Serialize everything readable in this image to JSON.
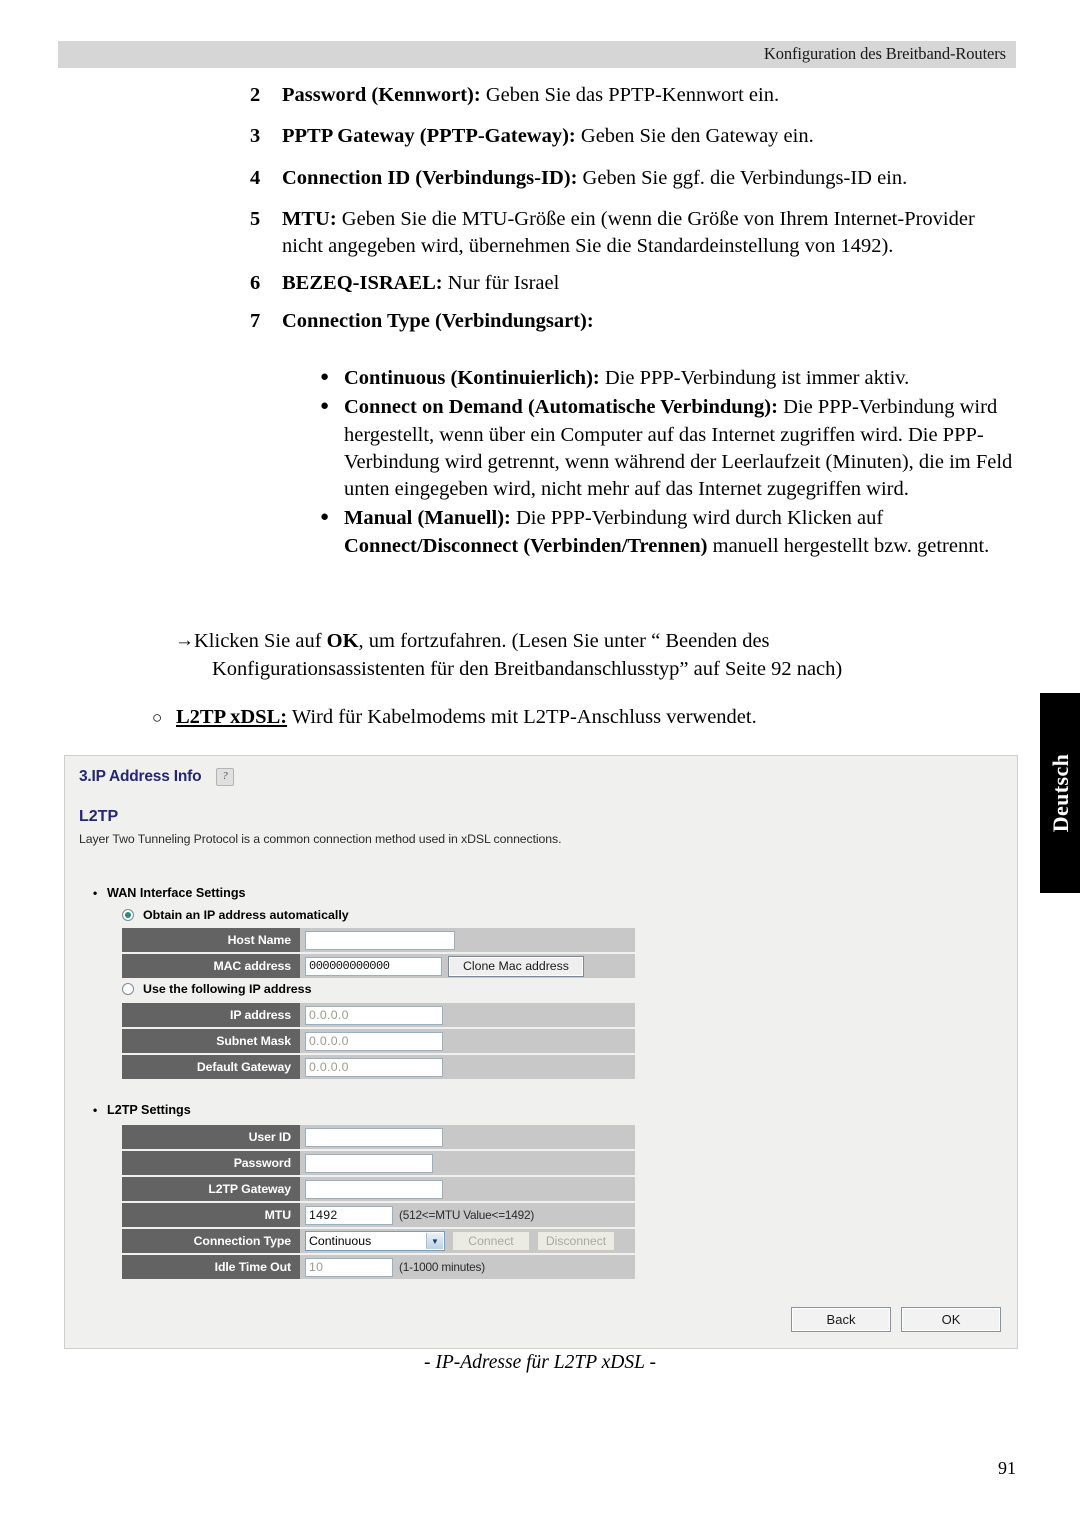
{
  "header": {
    "running_title": "Konfiguration des Breitband-Routers"
  },
  "side_tab": {
    "label": "Deutsch"
  },
  "steps": [
    {
      "num": "2",
      "bold": "Password (Kennwort):",
      "text": " Geben Sie das PPTP-Kennwort ein."
    },
    {
      "num": "3",
      "bold": "PPTP Gateway (PPTP-Gateway):",
      "text": " Geben Sie den Gateway ein."
    },
    {
      "num": "4",
      "bold": "Connection ID (Verbindungs-ID):",
      "text": " Geben Sie ggf. die Verbindungs-ID ein."
    },
    {
      "num": "5",
      "bold": "MTU:",
      "text": " Geben Sie die MTU-Größe ein (wenn die Größe von Ihrem Internet-Provider nicht angegeben wird, übernehmen Sie die Standardeinstellung von 1492)."
    },
    {
      "num": "6",
      "bold": "BEZEQ-ISRAEL:",
      "text": " Nur für Israel"
    },
    {
      "num": "7",
      "bold": "Connection Type (Verbindungsart):",
      "text": ""
    }
  ],
  "subbullets": [
    {
      "bold": "Continuous (Kontinuierlich):",
      "text": " Die PPP-Verbindung ist immer aktiv."
    },
    {
      "bold": "Connect on Demand (Automatische Verbindung):",
      "text": " Die PPP-Verbindung wird hergestellt, wenn über ein Computer auf das Internet zugriffen wird. Die PPP-Verbindung wird getrennt, wenn während der Leerlaufzeit (Minuten), die im Feld unten eingegeben wird, nicht mehr auf das Internet zugegriffen wird."
    },
    {
      "bold": "Manual (Manuell):",
      "text": " Die PPP-Verbindung wird durch Klicken auf ",
      "bold2": "Connect/Disconnect (Verbinden/Trennen)",
      "text2": " manuell hergestellt bzw. getrennt."
    }
  ],
  "arrow_paragraph": {
    "arrow": "→",
    "pre": "Klicken Sie auf ",
    "bold": "OK",
    "post": ", um fortzufahren. (Lesen Sie unter “ Beenden des",
    "line2": "Konfigurationsassistenten für den Breitbandanschlusstyp” auf Seite  92 nach)"
  },
  "circle_line": {
    "bullet": "○",
    "bold": "L2TP xDSL:",
    "text": " Wird für Kabelmodems mit L2TP-Anschluss verwendet."
  },
  "router_panel": {
    "title": "3.IP Address Info",
    "help_icon": "help-icon",
    "section_title": "L2TP",
    "section_desc": "Layer Two Tunneling Protocol is a common connection method used in xDSL connections.",
    "accent_color": "#262673",
    "label_bg_color": "#636363",
    "row_bg_color": "#c8c8c8",
    "groups": [
      {
        "heading": "WAN Interface Settings",
        "radios": [
          {
            "label": "Obtain an IP address automatically",
            "selected": true
          },
          {
            "label": "Use the following IP address",
            "selected": false
          }
        ],
        "fields_auto": [
          {
            "label": "Host Name",
            "value": "",
            "placeholder": "",
            "hint": ""
          },
          {
            "label": "MAC address",
            "value": "000000000000",
            "placeholder": "",
            "hint": "",
            "button": "Clone Mac address"
          }
        ],
        "fields_static": [
          {
            "label": "IP address",
            "value": "0.0.0.0",
            "is_placeholder": true
          },
          {
            "label": "Subnet Mask",
            "value": "0.0.0.0",
            "is_placeholder": true
          },
          {
            "label": "Default Gateway",
            "value": "0.0.0.0",
            "is_placeholder": true
          }
        ]
      },
      {
        "heading": "L2TP Settings",
        "fields": [
          {
            "label": "User ID",
            "value": ""
          },
          {
            "label": "Password",
            "value": ""
          },
          {
            "label": "L2TP Gateway",
            "value": ""
          },
          {
            "label": "MTU",
            "value": "1492",
            "hint": "(512<=MTU Value<=1492)"
          },
          {
            "label": "Connection Type",
            "select_value": "Continuous",
            "buttons": [
              "Connect",
              "Disconnect"
            ]
          },
          {
            "label": "Idle Time Out",
            "value": "10",
            "is_placeholder": true,
            "hint": "(1-1000 minutes)"
          }
        ]
      }
    ],
    "nav_buttons": [
      {
        "label": "Back"
      },
      {
        "label": "OK"
      }
    ]
  },
  "figure_caption": "- IP-Adresse für L2TP xDSL -",
  "page_number": "91"
}
